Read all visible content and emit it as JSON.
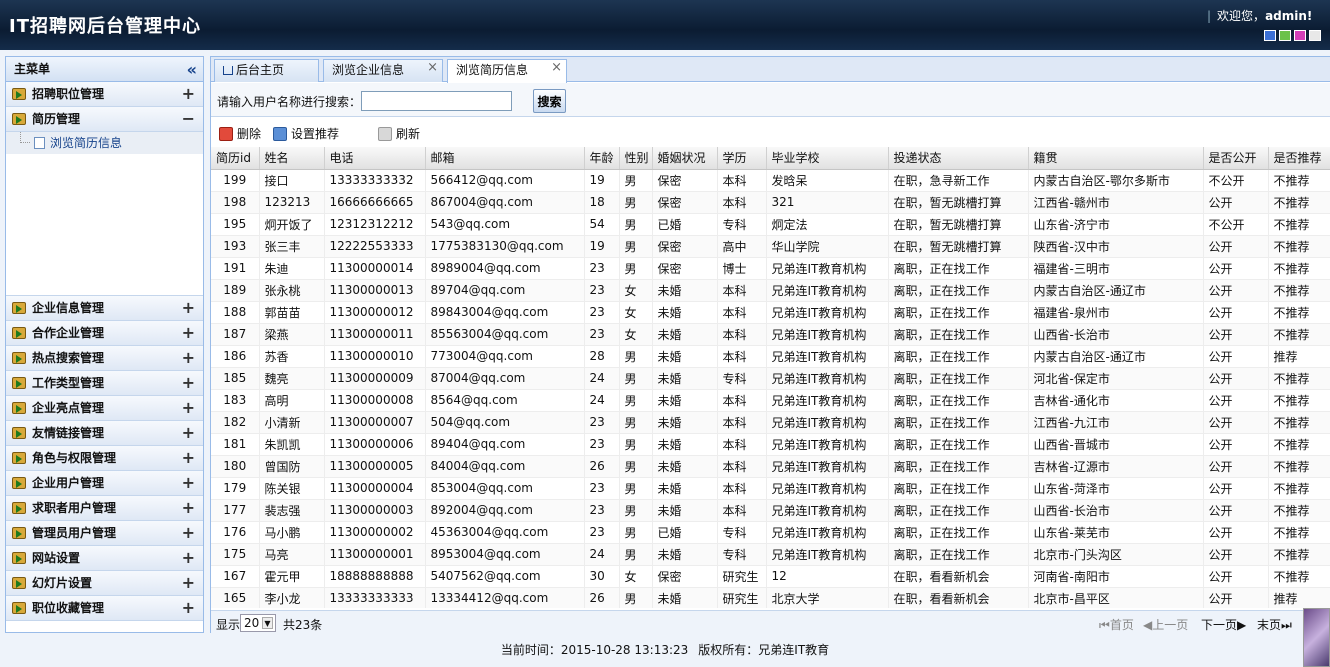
{
  "header": {
    "title": "IT招聘网后台管理中心",
    "welcome_prefix": "欢迎您，",
    "user": "admin",
    "welcome_suffix": "!",
    "theme_colors": [
      "#3b6fd4",
      "#6cc24a",
      "#d23fb8",
      "#e8e8e8"
    ]
  },
  "sidebar": {
    "title": "主菜单",
    "items": [
      {
        "label": "招聘职位管理",
        "toggle": "+"
      },
      {
        "label": "简历管理",
        "toggle": "−"
      },
      {
        "label": "企业信息管理",
        "toggle": "+"
      },
      {
        "label": "合作企业管理",
        "toggle": "+"
      },
      {
        "label": "热点搜索管理",
        "toggle": "+"
      },
      {
        "label": "工作类型管理",
        "toggle": "+"
      },
      {
        "label": "企业亮点管理",
        "toggle": "+"
      },
      {
        "label": "友情链接管理",
        "toggle": "+"
      },
      {
        "label": "角色与权限管理",
        "toggle": "+"
      },
      {
        "label": "企业用户管理",
        "toggle": "+"
      },
      {
        "label": "求职者用户管理",
        "toggle": "+"
      },
      {
        "label": "管理员用户管理",
        "toggle": "+"
      },
      {
        "label": "网站设置",
        "toggle": "+"
      },
      {
        "label": "幻灯片设置",
        "toggle": "+"
      },
      {
        "label": "职位收藏管理",
        "toggle": "+"
      }
    ],
    "subitem": "浏览简历信息"
  },
  "tabs": [
    {
      "label": "后台主页"
    },
    {
      "label": "浏览企业信息"
    },
    {
      "label": "浏览简历信息"
    }
  ],
  "search": {
    "label": "请输入用户名称进行搜索：",
    "value": "",
    "button": "搜索"
  },
  "toolbar": {
    "delete": "删除",
    "recommend": "设置推荐",
    "refresh": "刷新"
  },
  "table": {
    "headers": [
      "简历id",
      "姓名",
      "电话",
      "邮箱",
      "年龄",
      "性别",
      "婚姻状况",
      "学历",
      "毕业学校",
      "投递状态",
      "籍贯",
      "是否公开",
      "是否推荐"
    ],
    "rows": [
      [
        "199",
        "接口",
        "13333333332",
        "566412@qq.com",
        "19",
        "男",
        "保密",
        "本科",
        "发晗呆",
        "在职，急寻新工作",
        "内蒙古自治区-鄂尔多斯市",
        "不公开",
        "不推荐"
      ],
      [
        "198",
        "123213",
        "16666666665",
        "867004@qq.com",
        "18",
        "男",
        "保密",
        "本科",
        "321",
        "在职，暂无跳槽打算",
        "江西省-赣州市",
        "公开",
        "不推荐"
      ],
      [
        "195",
        "炯开饭了",
        "12312312212",
        "543@qq.com",
        "54",
        "男",
        "已婚",
        "专科",
        "炯定法",
        "在职，暂无跳槽打算",
        "山东省-济宁市",
        "不公开",
        "不推荐"
      ],
      [
        "193",
        "张三丰",
        "12222553333",
        "1775383130@qq.com",
        "19",
        "男",
        "保密",
        "高中",
        "华山学院",
        "在职，暂无跳槽打算",
        "陕西省-汉中市",
        "公开",
        "不推荐"
      ],
      [
        "191",
        "朱迪",
        "11300000014",
        "8989004@qq.com",
        "23",
        "男",
        "保密",
        "博士",
        "兄弟连IT教育机构",
        "离职，正在找工作",
        "福建省-三明市",
        "公开",
        "不推荐"
      ],
      [
        "189",
        "张永桃",
        "11300000013",
        "89704@qq.com",
        "23",
        "女",
        "未婚",
        "本科",
        "兄弟连IT教育机构",
        "离职，正在找工作",
        "内蒙古自治区-通辽市",
        "公开",
        "不推荐"
      ],
      [
        "188",
        "郭苗苗",
        "11300000012",
        "89843004@qq.com",
        "23",
        "女",
        "未婚",
        "本科",
        "兄弟连IT教育机构",
        "离职，正在找工作",
        "福建省-泉州市",
        "公开",
        "不推荐"
      ],
      [
        "187",
        "梁燕",
        "11300000011",
        "85563004@qq.com",
        "23",
        "女",
        "未婚",
        "本科",
        "兄弟连IT教育机构",
        "离职，正在找工作",
        "山西省-长治市",
        "公开",
        "不推荐"
      ],
      [
        "186",
        "苏香",
        "11300000010",
        "773004@qq.com",
        "28",
        "男",
        "未婚",
        "本科",
        "兄弟连IT教育机构",
        "离职，正在找工作",
        "内蒙古自治区-通辽市",
        "公开",
        "推荐"
      ],
      [
        "185",
        "魏亮",
        "11300000009",
        "87004@qq.com",
        "24",
        "男",
        "未婚",
        "专科",
        "兄弟连IT教育机构",
        "离职，正在找工作",
        "河北省-保定市",
        "公开",
        "不推荐"
      ],
      [
        "183",
        "高明",
        "11300000008",
        "8564@qq.com",
        "24",
        "男",
        "未婚",
        "本科",
        "兄弟连IT教育机构",
        "离职，正在找工作",
        "吉林省-通化市",
        "公开",
        "不推荐"
      ],
      [
        "182",
        "小清新",
        "11300000007",
        "504@qq.com",
        "23",
        "男",
        "未婚",
        "本科",
        "兄弟连IT教育机构",
        "离职，正在找工作",
        "江西省-九江市",
        "公开",
        "不推荐"
      ],
      [
        "181",
        "朱凯凯",
        "11300000006",
        "89404@qq.com",
        "23",
        "男",
        "未婚",
        "本科",
        "兄弟连IT教育机构",
        "离职，正在找工作",
        "山西省-晋城市",
        "公开",
        "不推荐"
      ],
      [
        "180",
        "曾国防",
        "11300000005",
        "84004@qq.com",
        "26",
        "男",
        "未婚",
        "本科",
        "兄弟连IT教育机构",
        "离职，正在找工作",
        "吉林省-辽源市",
        "公开",
        "不推荐"
      ],
      [
        "179",
        "陈关银",
        "11300000004",
        "853004@qq.com",
        "23",
        "男",
        "未婚",
        "本科",
        "兄弟连IT教育机构",
        "离职，正在找工作",
        "山东省-菏泽市",
        "公开",
        "不推荐"
      ],
      [
        "177",
        "裴志强",
        "11300000003",
        "892004@qq.com",
        "23",
        "男",
        "未婚",
        "本科",
        "兄弟连IT教育机构",
        "离职，正在找工作",
        "山西省-长治市",
        "公开",
        "不推荐"
      ],
      [
        "176",
        "马小鹏",
        "11300000002",
        "45363004@qq.com",
        "23",
        "男",
        "已婚",
        "专科",
        "兄弟连IT教育机构",
        "离职，正在找工作",
        "山东省-莱芜市",
        "公开",
        "不推荐"
      ],
      [
        "175",
        "马亮",
        "11300000001",
        "8953004@qq.com",
        "24",
        "男",
        "未婚",
        "专科",
        "兄弟连IT教育机构",
        "离职，正在找工作",
        "北京市-门头沟区",
        "公开",
        "不推荐"
      ],
      [
        "167",
        "霍元甲",
        "18888888888",
        "5407562@qq.com",
        "30",
        "女",
        "保密",
        "研究生",
        "12",
        "在职，看看新机会",
        "河南省-南阳市",
        "公开",
        "不推荐"
      ],
      [
        "165",
        "李小龙",
        "13333333333",
        "13334412@qq.com",
        "26",
        "男",
        "未婚",
        "研究生",
        "北京大学",
        "在职，看看新机会",
        "北京市-昌平区",
        "公开",
        "推荐"
      ]
    ]
  },
  "pager": {
    "show_label": "显示",
    "page_size": "20",
    "total": "共23条",
    "first": "首页",
    "prev": "上一页",
    "next": "下一页",
    "last": "末页"
  },
  "footer": {
    "time_label": "当前时间：",
    "time": "2015-10-28 13:13:23",
    "copyright_label": "版权所有：",
    "copyright": "兄弟连IT教育"
  }
}
